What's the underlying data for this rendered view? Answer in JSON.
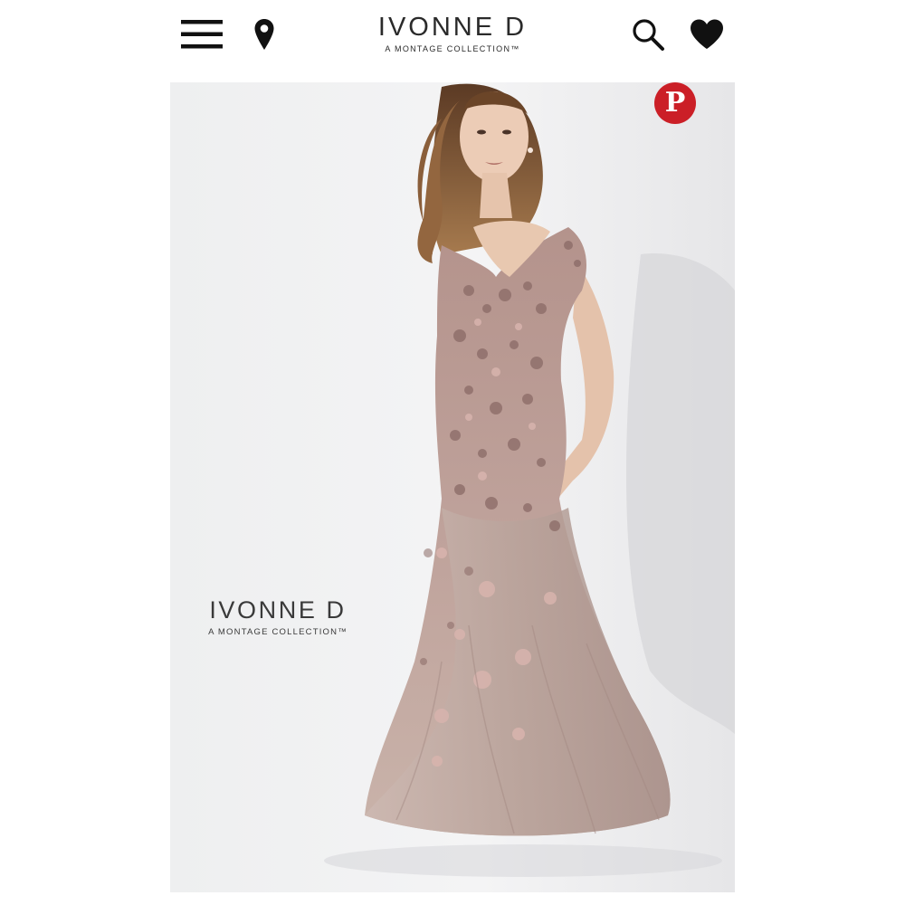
{
  "header": {
    "icons": {
      "menu": "hamburger-menu-icon",
      "store_locator": "map-pin-icon",
      "search": "search-icon",
      "wishlist": "heart-icon"
    },
    "logo": {
      "main": "IVONNE D",
      "sub": "A MONTAGE COLLECTION™"
    }
  },
  "hero": {
    "watermark": {
      "main": "IVONNE D",
      "sub": "A MONTAGE COLLECTION™"
    },
    "share_icon": "pinterest-icon",
    "pinterest_glyph": "P",
    "colors": {
      "pinterest": "#cb1f27",
      "gown": "#b89a92",
      "lace": "#8a6a66"
    }
  }
}
